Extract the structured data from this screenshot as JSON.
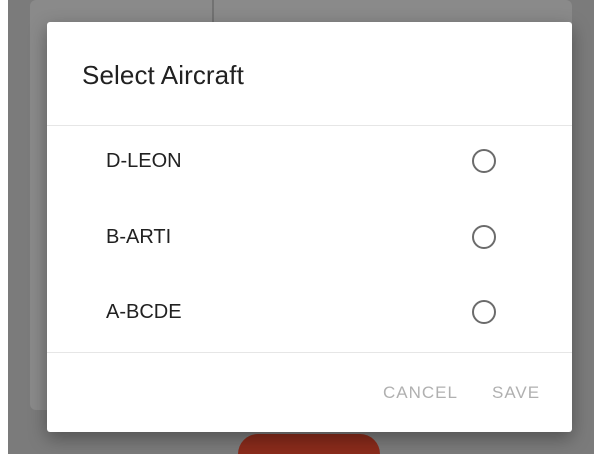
{
  "dialog": {
    "title": "Select Aircraft",
    "options": [
      {
        "label": "D-LEON",
        "selected": false
      },
      {
        "label": "B-ARTI",
        "selected": false
      },
      {
        "label": "A-BCDE",
        "selected": false
      }
    ],
    "actions": {
      "cancel_label": "CANCEL",
      "save_label": "SAVE"
    }
  },
  "colors": {
    "scrim": "#7b7b7b",
    "dialog_bg": "#ffffff",
    "text_primary": "#212121",
    "action_disabled": "#b0b0b0",
    "radio_border": "#6b6b6b",
    "bottom_button": "#8a2b1b"
  }
}
